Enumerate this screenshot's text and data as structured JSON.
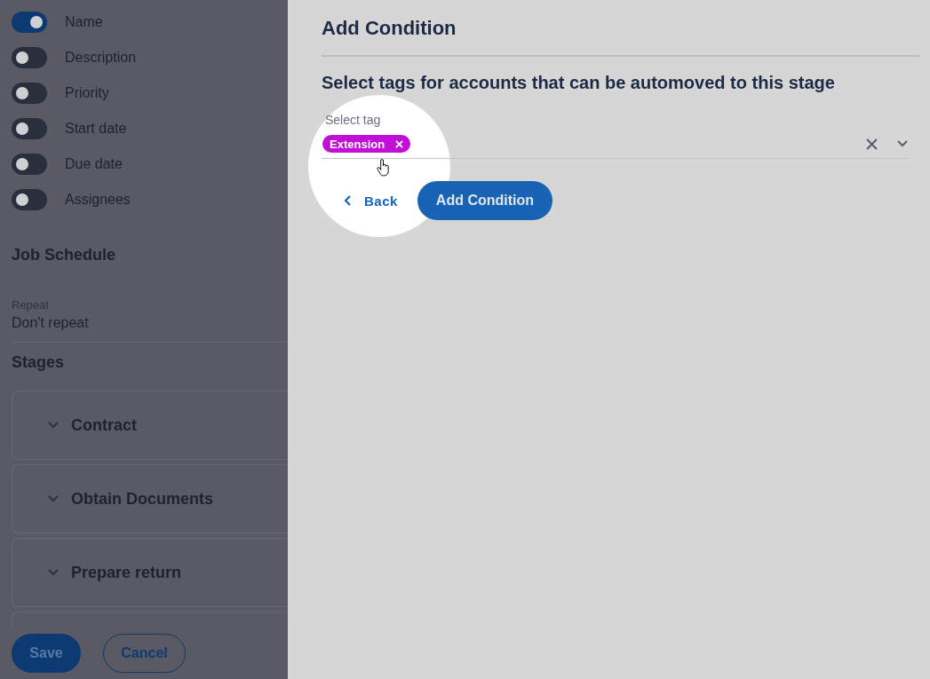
{
  "left_panel": {
    "field_toggles": [
      {
        "label": "Name",
        "on": true
      },
      {
        "label": "Description",
        "on": false
      },
      {
        "label": "Priority",
        "on": false
      },
      {
        "label": "Start date",
        "on": false
      },
      {
        "label": "Due date",
        "on": false
      },
      {
        "label": "Assignees",
        "on": false
      }
    ],
    "job_schedule": {
      "title": "Job Schedule",
      "repeat_label": "Repeat",
      "repeat_value": "Don't repeat"
    },
    "stages": {
      "title": "Stages",
      "items": [
        {
          "name": "Contract"
        },
        {
          "name": "Obtain Documents"
        },
        {
          "name": "Prepare return"
        }
      ]
    },
    "save_button": "Save",
    "cancel_button": "Cancel"
  },
  "dialog": {
    "title": "Add Condition",
    "prompt": "Select tags for accounts that can be automoved to this stage",
    "tag_field": {
      "label": "Select tag",
      "tags": [
        {
          "label": "Extension"
        }
      ]
    },
    "back_link": "Back",
    "submit_button": "Add Condition"
  }
}
